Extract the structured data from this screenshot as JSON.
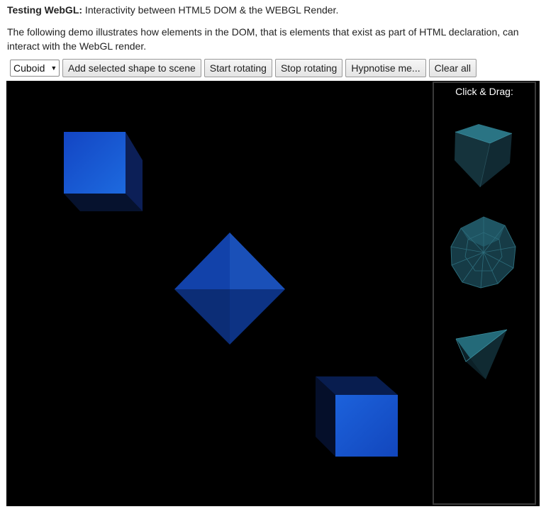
{
  "header": {
    "title_bold": "Testing WebGL:",
    "title_rest": " Interactivity between HTML5 DOM & the WEBGL Render.",
    "description": "The following demo illustrates how elements in the DOM, that is elements that exist as part of HTML declaration, can interact with the WebGL render."
  },
  "toolbar": {
    "shape_select": {
      "value": "Cuboid"
    },
    "add_label": "Add selected shape to scene",
    "start_label": "Start rotating",
    "stop_label": "Stop rotating",
    "hypnotise_label": "Hypnotise me...",
    "clear_label": "Clear all"
  },
  "palette": {
    "title": "Click & Drag:",
    "items": [
      "cube-icon",
      "sphere-icon",
      "pyramid-icon"
    ]
  },
  "colors": {
    "scene_background": "#000000",
    "shape_blue": "#1655d6",
    "palette_teal": "#1f5a68"
  }
}
